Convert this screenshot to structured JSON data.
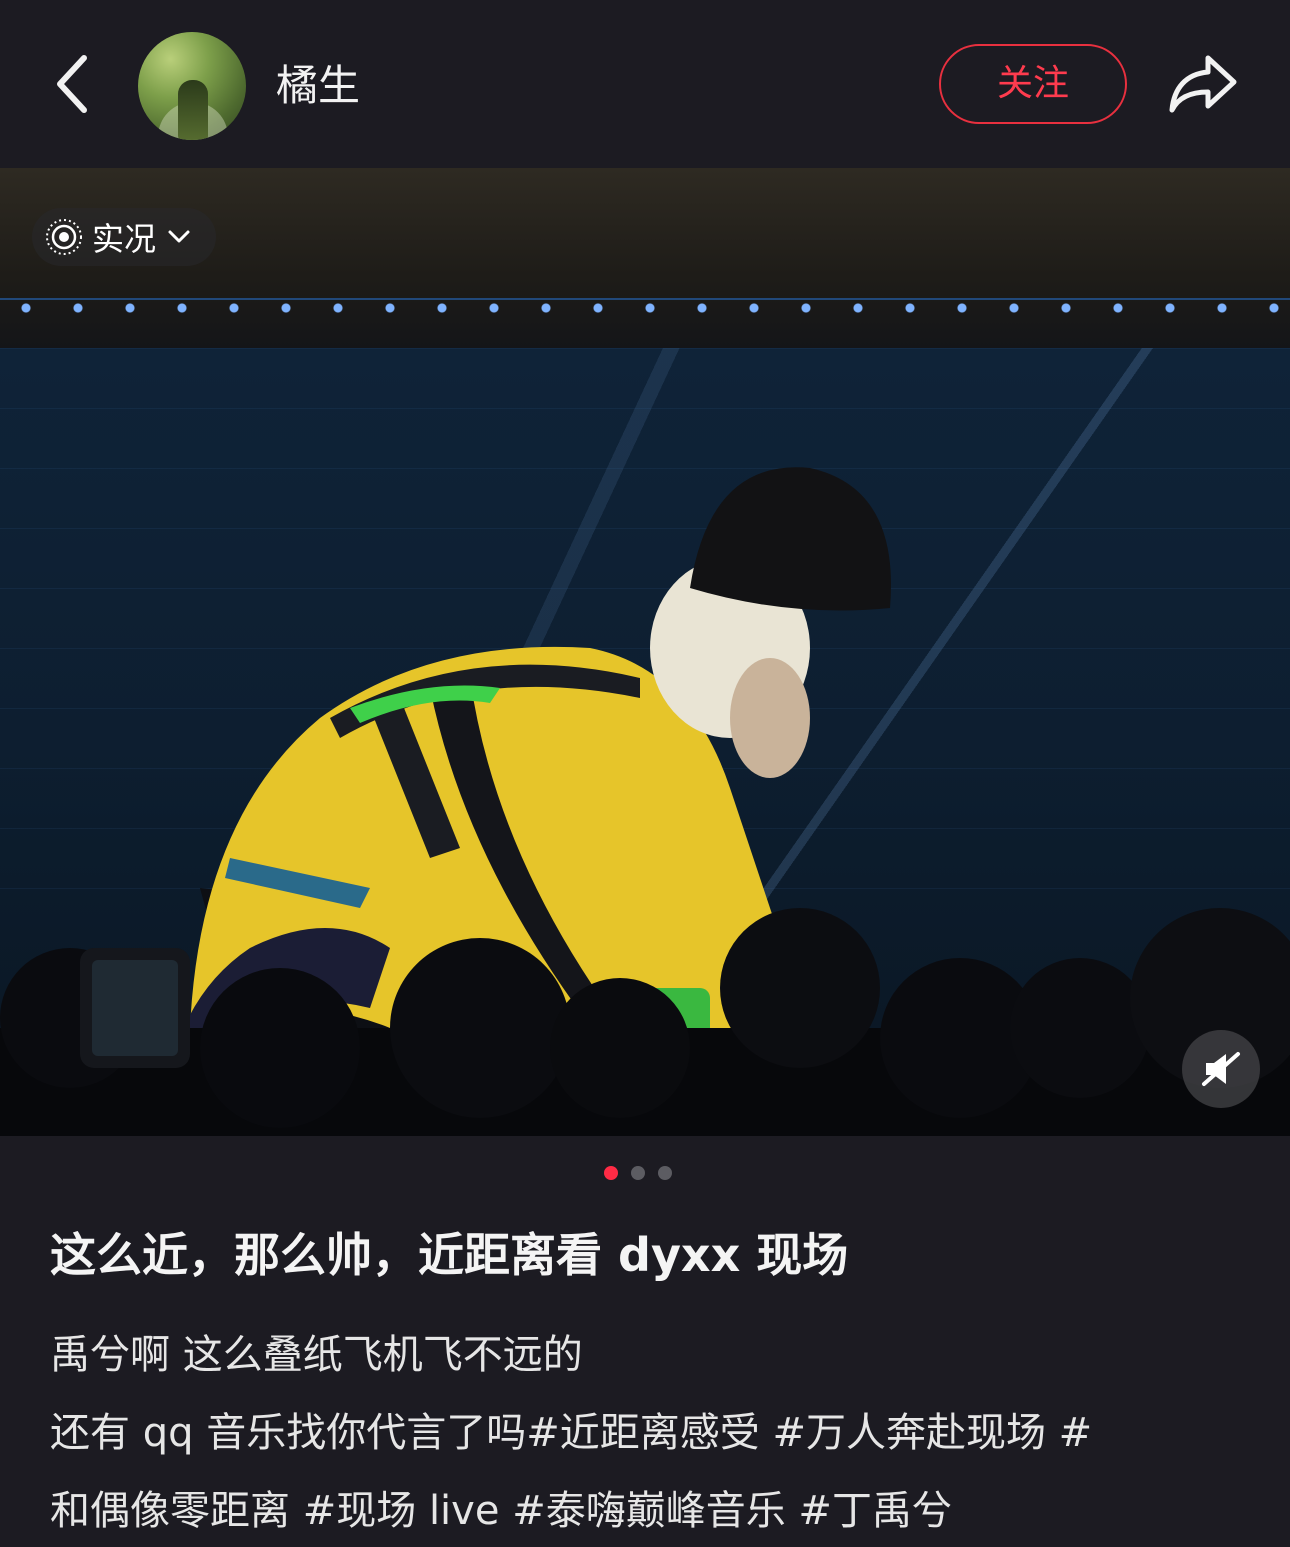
{
  "header": {
    "back_icon": "chevron-left-icon",
    "username": "橘生",
    "follow_label": "关注",
    "follow_color": "#e8303f",
    "share_icon": "share-arrow-icon"
  },
  "media": {
    "live_label": "实况",
    "live_icon": "live-photo-icon",
    "dropdown_icon": "chevron-down-icon",
    "mute_icon": "speaker-muted-icon",
    "page_count": 3,
    "active_page": 1,
    "active_dot_color": "#ff2b45"
  },
  "post": {
    "title": "这么近，那么帅，近距离看 dyxx 现场",
    "desc_line1": "禹兮啊 这么叠纸飞机飞不远的",
    "desc_line2_text": "还有 qq 音乐找你代言了吗",
    "tags": [
      "#近距离感受",
      "#万人奔赴现场",
      "#和偶像零距离",
      "#现场 live",
      "#泰嗨巅峰音乐",
      "#丁禹兮"
    ]
  }
}
